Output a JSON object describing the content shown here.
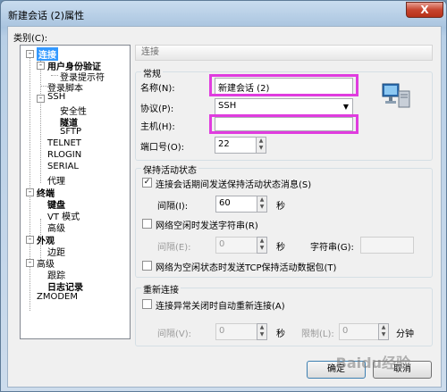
{
  "window": {
    "title": "新建会话 (2)属性",
    "close_label": "X"
  },
  "category_label": "类别(C):",
  "tree": [
    {
      "label": "连接",
      "level": 0,
      "bold": true,
      "selected": true,
      "expander": "-"
    },
    {
      "label": "用户身份验证",
      "level": 1,
      "bold": true,
      "expander": "-"
    },
    {
      "label": "登录提示符",
      "level": 2
    },
    {
      "label": "登录脚本",
      "level": 1
    },
    {
      "label": "SSH",
      "level": 1,
      "expander": "-"
    },
    {
      "label": "安全性",
      "level": 2
    },
    {
      "label": "隧道",
      "level": 2,
      "bold": true
    },
    {
      "label": "SFTP",
      "level": 2
    },
    {
      "label": "TELNET",
      "level": 1
    },
    {
      "label": "RLOGIN",
      "level": 1
    },
    {
      "label": "SERIAL",
      "level": 1
    },
    {
      "label": "代理",
      "level": 1
    },
    {
      "label": "终端",
      "level": 0,
      "bold": true,
      "expander": "-"
    },
    {
      "label": "键盘",
      "level": 1,
      "bold": true
    },
    {
      "label": "VT 模式",
      "level": 1
    },
    {
      "label": "高级",
      "level": 1
    },
    {
      "label": "外观",
      "level": 0,
      "bold": true,
      "expander": "-"
    },
    {
      "label": "边距",
      "level": 1
    },
    {
      "label": "高级",
      "level": 0,
      "expander": "-"
    },
    {
      "label": "跟踪",
      "level": 1
    },
    {
      "label": "日志记录",
      "level": 1,
      "bold": true
    },
    {
      "label": "ZMODEM",
      "level": 0
    }
  ],
  "panel": {
    "header": "连接",
    "general": {
      "title": "常规",
      "name_label": "名称(N):",
      "name_value": "新建会话 (2)",
      "protocol_label": "协议(P):",
      "protocol_value": "SSH",
      "host_label": "主机(H):",
      "host_value": "",
      "port_label": "端口号(O):",
      "port_value": "22"
    },
    "keepalive": {
      "title": "保持活动状态",
      "send_keepalive_label": "连接会话期间发送保持活动状态消息(S)",
      "send_keepalive_checked": true,
      "interval_label": "间隔(I):",
      "interval_value": "60",
      "interval_unit": "秒",
      "send_string_label": "网络空闲时发送字符串(R)",
      "send_string_checked": false,
      "interval2_label": "间隔(E):",
      "interval2_value": "0",
      "interval2_unit": "秒",
      "string_label": "字符串(G):",
      "string_value": "",
      "tcp_keepalive_label": "网络为空闲状态时发送TCP保持活动数据包(T)",
      "tcp_keepalive_checked": false
    },
    "reconnect": {
      "title": "重新连接",
      "auto_reconnect_label": "连接异常关闭时自动重新连接(A)",
      "auto_reconnect_checked": false,
      "interval_label": "间隔(V):",
      "interval_value": "0",
      "interval_unit": "秒",
      "limit_label": "限制(L):",
      "limit_value": "0",
      "limit_unit": "分钟"
    }
  },
  "buttons": {
    "ok": "确定",
    "cancel": "取消"
  },
  "watermark": "Baidu经验",
  "colors": {
    "highlight": "#e03cdf",
    "selection": "#3399ff"
  }
}
